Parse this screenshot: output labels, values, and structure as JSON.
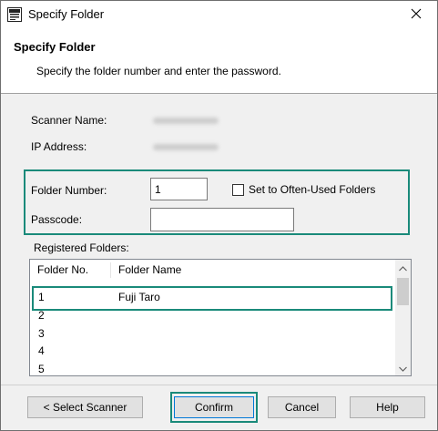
{
  "window": {
    "title": "Specify Folder",
    "icon": "scanner-app-icon",
    "close_icon": "close-icon"
  },
  "header": {
    "title": "Specify Folder",
    "subtitle": "Specify the folder number and enter the password."
  },
  "info": {
    "scanner_name_label": "Scanner Name:",
    "ip_address_label": "IP Address:"
  },
  "form": {
    "folder_number_label": "Folder Number:",
    "folder_number_value": "1",
    "often_used_label": "Set to Often-Used Folders",
    "often_used_checked": false,
    "passcode_label": "Passcode:",
    "passcode_value": ""
  },
  "registered": {
    "label": "Registered Folders:",
    "columns": [
      "Folder No.",
      "Folder Name"
    ],
    "rows": [
      {
        "no": "1",
        "name": "Fuji Taro",
        "selected": true
      },
      {
        "no": "2",
        "name": ""
      },
      {
        "no": "3",
        "name": ""
      },
      {
        "no": "4",
        "name": ""
      },
      {
        "no": "5",
        "name": ""
      }
    ]
  },
  "buttons": {
    "select_scanner": "< Select Scanner",
    "confirm": "Confirm",
    "cancel": "Cancel",
    "help": "Help"
  },
  "colors": {
    "highlight": "#1a8a7a",
    "selection_border": "#1a8a7a"
  }
}
